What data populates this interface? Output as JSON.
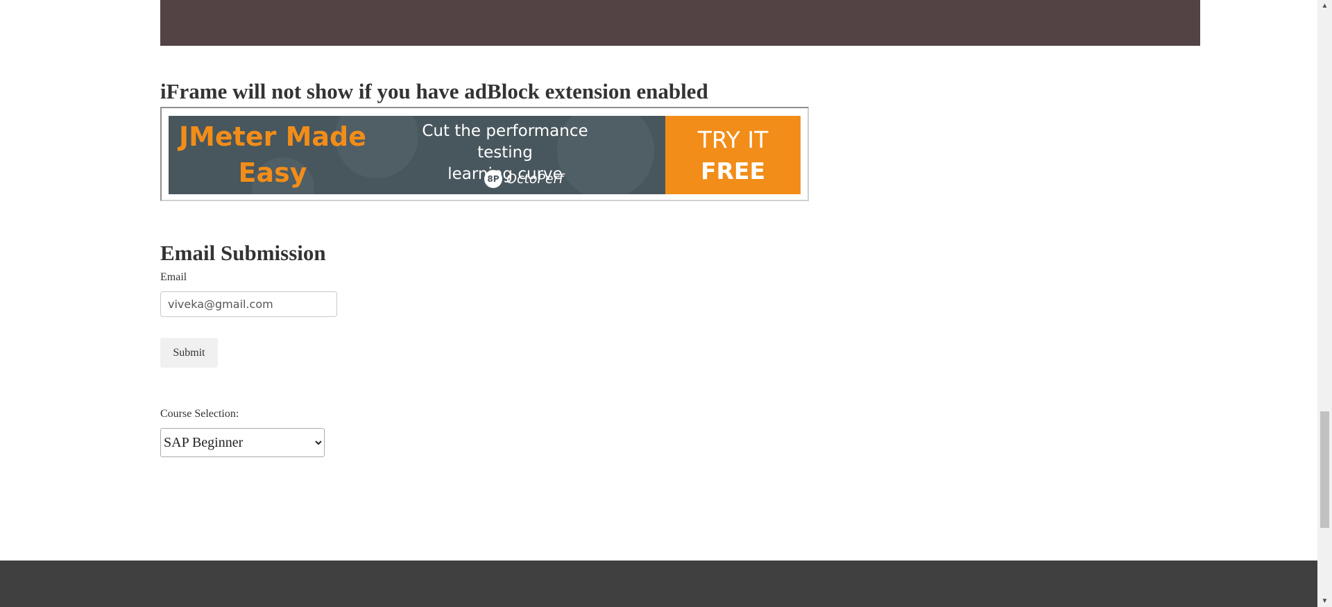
{
  "iframe_section": {
    "heading": "iFrame will not show if you have adBlock extension enabled",
    "ad": {
      "title_line1": "JMeter Made",
      "title_line2": "Easy",
      "tagline_line1": "Cut the performance testing",
      "tagline_line2": "learning curve",
      "brand": "OctoPerf",
      "logo_text": "8P",
      "cta_line1": "TRY IT",
      "cta_line2": "FREE"
    }
  },
  "email_section": {
    "heading": "Email Submission",
    "email_label": "Email",
    "email_value": "viveka@gmail.com",
    "submit_label": "Submit"
  },
  "course_section": {
    "label": "Course Selection:",
    "selected": "SAP Beginner"
  },
  "colors": {
    "top_bar": "#534344",
    "ad_background": "#48565d",
    "ad_accent": "#f28d19",
    "footer": "#404040"
  }
}
